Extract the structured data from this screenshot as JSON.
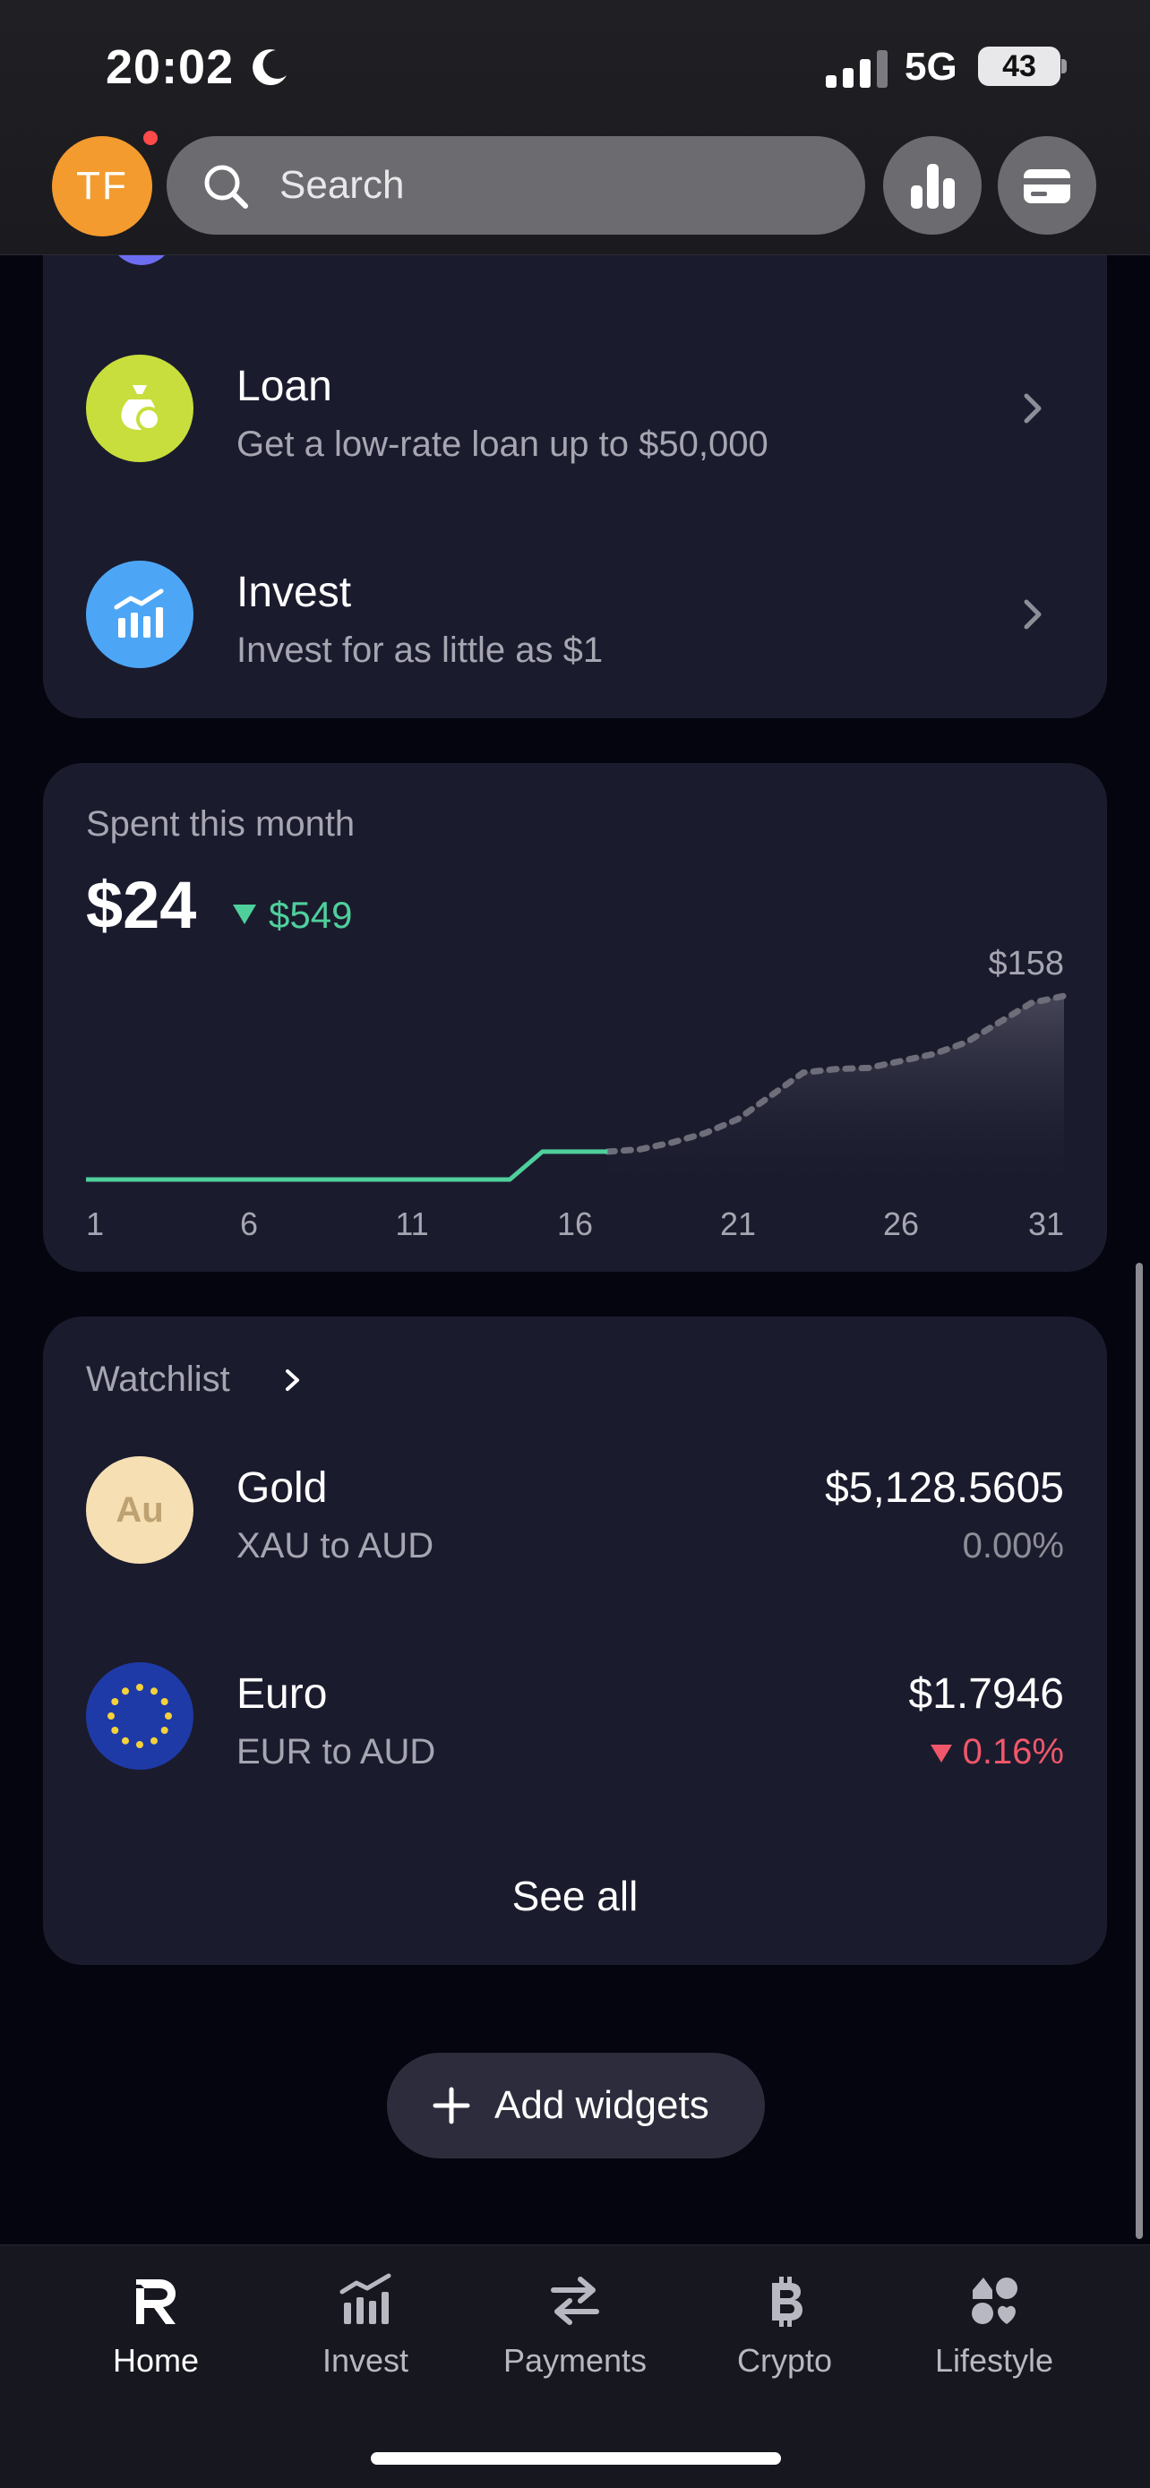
{
  "status_bar": {
    "time": "20:02",
    "network": "5G",
    "battery": "43"
  },
  "header": {
    "avatar_initials": "TF",
    "search_placeholder": "Search"
  },
  "products": [
    {
      "title": "Loan",
      "subtitle": "Get a low-rate loan up to $50,000",
      "icon": "money-bag-icon",
      "color": "#c8de3c"
    },
    {
      "title": "Invest",
      "subtitle": "Invest for as little as $1",
      "icon": "bar-chart-icon",
      "color": "#4da6f5"
    }
  ],
  "spending": {
    "label": "Spent this month",
    "amount": "$24",
    "delta": "$549",
    "delta_color": "#4fcf9b",
    "accent": "#4fcf9b"
  },
  "chart_data": {
    "type": "line",
    "title": "",
    "xlabel": "",
    "ylabel": "",
    "x_ticks": [
      "1",
      "6",
      "11",
      "16",
      "21",
      "26",
      "31"
    ],
    "xlim": [
      1,
      31
    ],
    "ylim": [
      0,
      158
    ],
    "max_label": "$158",
    "series": [
      {
        "style": "solid",
        "points": [
          [
            1,
            0
          ],
          [
            14,
            0
          ],
          [
            15,
            24
          ],
          [
            17,
            24
          ]
        ]
      },
      {
        "style": "dotted-area",
        "points": [
          [
            17,
            24
          ],
          [
            18,
            26
          ],
          [
            19,
            32
          ],
          [
            20,
            40
          ],
          [
            21,
            52
          ],
          [
            22,
            72
          ],
          [
            23,
            92
          ],
          [
            24,
            95
          ],
          [
            25,
            96
          ],
          [
            26,
            102
          ],
          [
            27,
            108
          ],
          [
            28,
            118
          ],
          [
            29,
            135
          ],
          [
            30,
            152
          ],
          [
            31,
            158
          ]
        ]
      }
    ]
  },
  "watchlist": {
    "header": "Watchlist",
    "items": [
      {
        "name": "Gold",
        "pair": "XAU to AUD",
        "price": "$5,128.5605",
        "change": "0.00%",
        "change_color": "#8e8e98",
        "icon_text": "Au",
        "icon": "gold-icon"
      },
      {
        "name": "Euro",
        "pair": "EUR to AUD",
        "price": "$1.7946",
        "change": "0.16%",
        "change_color": "#f0576a",
        "icon": "eu-flag-icon"
      }
    ],
    "see_all": "See all"
  },
  "add_widgets": "Add widgets",
  "nav": [
    {
      "label": "Home",
      "icon": "revolut-r-icon",
      "active": true
    },
    {
      "label": "Invest",
      "icon": "invest-chart-icon",
      "active": false
    },
    {
      "label": "Payments",
      "icon": "arrows-swap-icon",
      "active": false
    },
    {
      "label": "Crypto",
      "icon": "bitcoin-icon",
      "active": false
    },
    {
      "label": "Lifestyle",
      "icon": "lifestyle-grid-icon",
      "active": false
    }
  ]
}
